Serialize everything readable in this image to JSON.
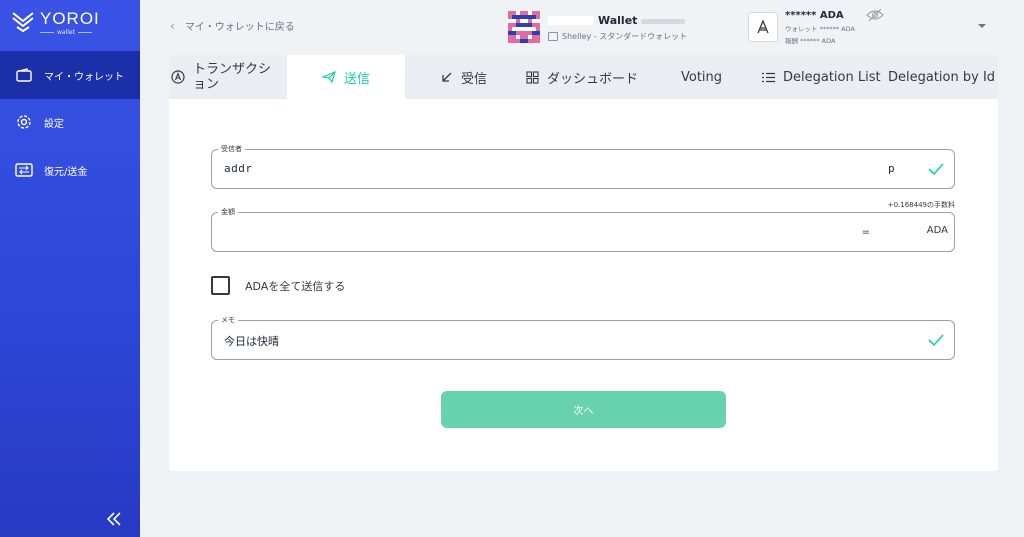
{
  "brand": {
    "name": "YOROI",
    "sub": "wallet"
  },
  "sidebar": {
    "items": [
      {
        "label": "マイ・ウォレット",
        "icon": "wallet-icon",
        "active": true
      },
      {
        "label": "設定",
        "icon": "gear-icon",
        "active": false
      },
      {
        "label": "復元/送金",
        "icon": "transfer-icon",
        "active": false
      }
    ],
    "collapse_icon": "double-chevron-left-icon"
  },
  "header": {
    "back_label": "マイ・ウォレットに戻る",
    "wallet_name": "Wallet",
    "wallet_type": "Shelley - スタンダードウォレット",
    "balance_main": "****** ADA",
    "balance_wallet": "ウォレット ****** ADA",
    "balance_reward": "報酬 ****** ADA"
  },
  "tabs": [
    {
      "label": "トランザクション",
      "icon": "transactions-icon",
      "active": false
    },
    {
      "label": "送信",
      "icon": "send-icon",
      "active": true
    },
    {
      "label": "受信",
      "icon": "receive-icon",
      "active": false
    },
    {
      "label": "ダッシュボード",
      "icon": "dashboard-icon",
      "active": false
    },
    {
      "label": "Voting",
      "icon": "",
      "active": false
    },
    {
      "label": "Delegation List",
      "icon": "list-icon",
      "active": false
    },
    {
      "label": "Delegation by Id",
      "icon": "",
      "active": false
    }
  ],
  "form": {
    "receiver_label": "受信者",
    "receiver_value": "addr",
    "receiver_tail": "p",
    "amount_label": "金額",
    "fee_text": "+0.168449の手数料",
    "amount_eq": "=",
    "amount_unit": "ADA",
    "send_all_label": "ADAを全て送信する",
    "memo_label": "メモ",
    "memo_value": "今日は快晴",
    "next_label": "次へ"
  },
  "colors": {
    "sidebar": "#2c47d6",
    "sidebar_active": "#1a2fa8",
    "accent": "#17d1aa",
    "button": "#5fd0a9"
  }
}
